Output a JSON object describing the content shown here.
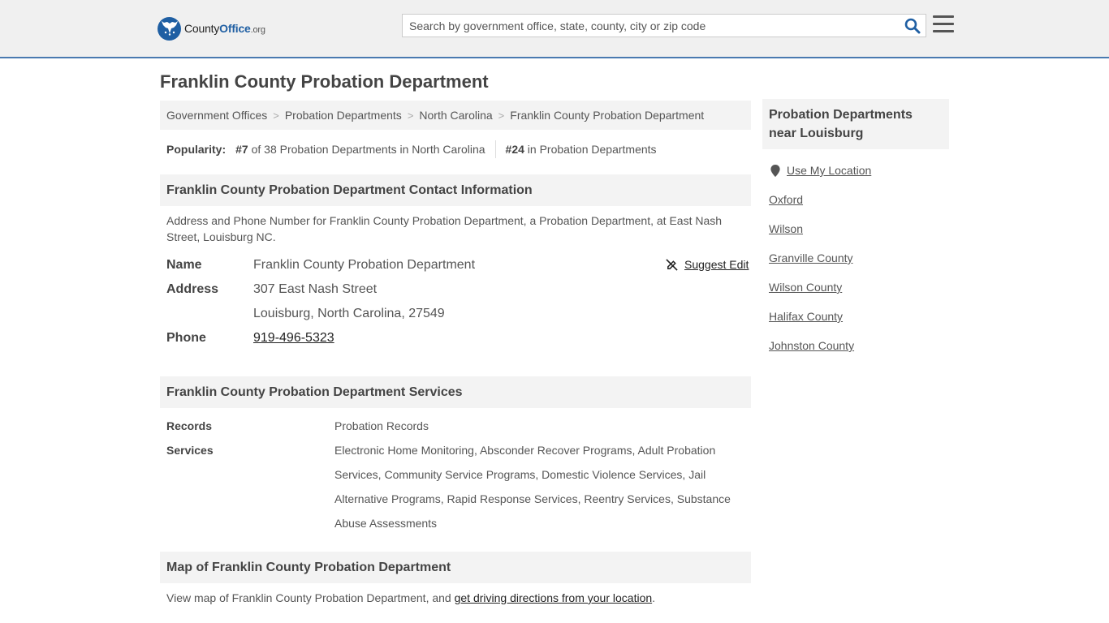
{
  "header": {
    "logo_county": "County",
    "logo_office": "Office",
    "logo_org": ".org",
    "search_placeholder": "Search by government office, state, county, city or zip code"
  },
  "page_title": "Franklin County Probation Department",
  "breadcrumb": [
    "Government Offices",
    "Probation Departments",
    "North Carolina",
    "Franklin County Probation Department"
  ],
  "popularity": {
    "label": "Popularity:",
    "rank_state": "#7",
    "rank_state_text": "of 38 Probation Departments in North Carolina",
    "rank_all": "#24",
    "rank_all_text": "in Probation Departments"
  },
  "contact": {
    "heading": "Franklin County Probation Department Contact Information",
    "description": "Address and Phone Number for Franklin County Probation Department, a Probation Department, at East Nash Street, Louisburg NC.",
    "name_label": "Name",
    "name_value": "Franklin County Probation Department",
    "address_label": "Address",
    "address_line1": "307 East Nash Street",
    "address_line2": "Louisburg, North Carolina, 27549",
    "phone_label": "Phone",
    "phone_value": "919-496-5323",
    "suggest_edit": "Suggest Edit"
  },
  "services": {
    "heading": "Franklin County Probation Department Services",
    "records_label": "Records",
    "records_value": "Probation Records",
    "services_label": "Services",
    "services_value": "Electronic Home Monitoring, Absconder Recover Programs, Adult Probation Services, Community Service Programs, Domestic Violence Services, Jail Alternative Programs, Rapid Response Services, Reentry Services, Substance Abuse Assessments"
  },
  "map": {
    "heading": "Map of Franklin County Probation Department",
    "desc_prefix": "View map of Franklin County Probation Department, and ",
    "desc_link": "get driving directions from your location",
    "desc_suffix": "."
  },
  "sidebar": {
    "heading": "Probation Departments near Louisburg",
    "use_location": "Use My Location",
    "links": [
      "Oxford",
      "Wilson",
      "Granville County",
      "Wilson County",
      "Halifax County",
      "Johnston County"
    ]
  },
  "colors": {
    "accent": "#1f5fa3",
    "header_bg": "#f0f0f0",
    "section_bg": "#f3f3f3"
  }
}
